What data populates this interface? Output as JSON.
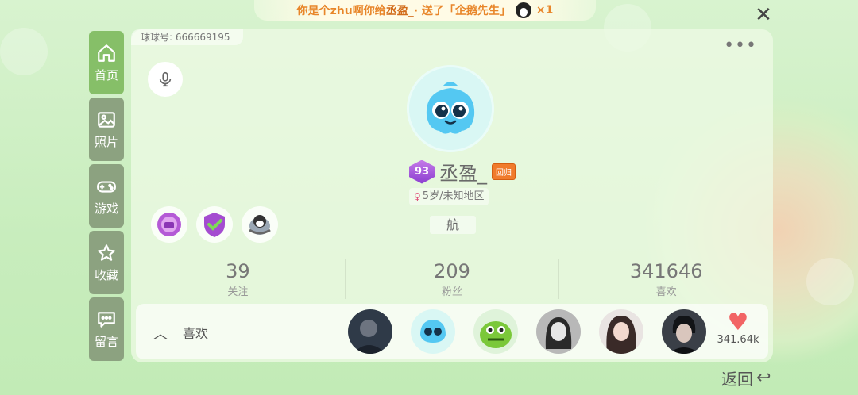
{
  "banner": {
    "text_pre": "你是个zhu啊你给",
    "target": "丞盈_",
    "text_mid": " · 送了「企鹅先生」",
    "count": "×1",
    "gift_icon": "penguin-icon"
  },
  "close_icon": "close-icon",
  "nav": {
    "items": [
      {
        "label": "首页",
        "icon": "home-icon",
        "active": true
      },
      {
        "label": "照片",
        "icon": "photo-icon",
        "active": false
      },
      {
        "label": "游戏",
        "icon": "gamepad-icon",
        "active": false
      },
      {
        "label": "收藏",
        "icon": "star-icon",
        "active": false
      },
      {
        "label": "留言",
        "icon": "message-icon",
        "active": false
      }
    ]
  },
  "profile": {
    "uid": "球球号: 666669195",
    "level": "93",
    "name": "丞盈_",
    "tag": "回归",
    "info": "5岁/未知地区",
    "signature": "航"
  },
  "stats": [
    {
      "value": "39",
      "label": "关注"
    },
    {
      "value": "209",
      "label": "粉丝"
    },
    {
      "value": "341646",
      "label": "喜欢"
    }
  ],
  "likes": {
    "label": "喜欢",
    "count": "341.64k"
  },
  "footer": {
    "back_label": "返回"
  },
  "colors": {
    "nav_active": "#86bf68",
    "nav_inactive": "#8ca280",
    "banner_text": "#e8862a",
    "heart": "#f26464"
  }
}
